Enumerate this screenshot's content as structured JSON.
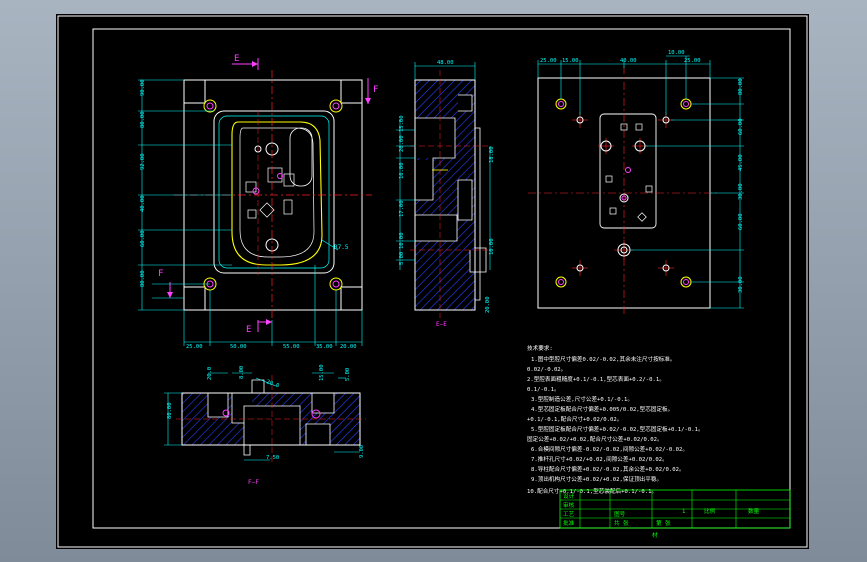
{
  "colors": {
    "background_outer": "#8e9aa8",
    "drawing_paper": "#000000",
    "border": "#ffffff",
    "dimension": "#00ffff",
    "part_outline": "#ffffff",
    "hatch": "#2a3fff",
    "center_line": "#ff2020",
    "cavity": "#ffff00",
    "hole_magenta": "#ff40ff",
    "title_block": "#00ff00",
    "notes_text": "#ffffff"
  },
  "section_labels": {
    "view_top_left_arrow_E_top": "E",
    "view_top_left_arrow_E_bottom": "E",
    "view_top_left_arrow_F_right": "F",
    "view_top_left_arrow_F_left": "F",
    "section_E": "E—E",
    "section_F": "F—F"
  },
  "dims_plan": {
    "left": [
      "90.00",
      "80.00",
      "92.00",
      "40.00",
      "60.00",
      "80.00"
    ],
    "bottom": [
      "25.00",
      "50.00",
      "55.00",
      "35.00",
      "20.00"
    ],
    "callout": "R7.5"
  },
  "dims_section_e": {
    "top": "48.00",
    "left": [
      "15.00",
      "26.00",
      "16.00",
      "17.00",
      "10.00",
      "5.00",
      "20.00"
    ],
    "right": [
      "18.00",
      "10.00"
    ]
  },
  "dims_right_plate": {
    "top": [
      "25.00",
      "15.00",
      "40.00",
      "25.00",
      "10.00"
    ],
    "right": [
      "80.00",
      "60.00",
      "45.00",
      "30.00",
      "60.00",
      "30.00"
    ]
  },
  "dims_section_f": {
    "left": "80.00",
    "top": [
      "20.0",
      "8.00",
      "20.0",
      "15.00",
      "5.00"
    ],
    "bottom": [
      "7.50",
      "9.00"
    ]
  },
  "notes": {
    "heading": "技术要求:",
    "lines": [
      "1.图中型腔尺寸偏差0.02/-0.02,其余未注尺寸按标准。",
      "0.02/-0.02。",
      "2.型腔表面粗糙度+0.1/-0.1,型芯表面+0.2/-0.1。",
      "0.1/-0.1。",
      "3.型腔制造公差,尺寸公差+0.1/-0.1。",
      "4.型芯固定板配合尺寸偏差+0.005/0.02,型芯固定板。",
      "+0.1/-0.1,配合尺寸+0.02/0.02。",
      "5.型腔固定板配合尺寸偏差+0.02/-0.02,型芯固定板+0.1/-0.1。",
      "固定公差+0.02/+0.02,配合尺寸公差+0.02/0.02。",
      "6.合模间隙尺寸偏差-0.02/-0.02,间隙公差+0.02/-0.02。",
      "7.推杆孔尺寸+0.02/+0.02,间隙公差+0.02/0.02。",
      "8.导柱配合尺寸偏差+0.02/-0.02,其余公差+0.02/0.02。",
      "9.顶出机构尺寸公差+0.02/+0.02,保证顶出平稳。",
      "10.配合尺寸+0.1/-0.1,型芯装配后+0.1/-0.1。"
    ]
  },
  "title_block": {
    "row1": [
      "设计",
      "",
      "",
      "",
      "",
      ""
    ],
    "row2": [
      "审核",
      "",
      "图号",
      "1",
      "比例",
      "数量"
    ],
    "row3": [
      "工艺",
      "",
      "",
      "",
      "",
      ""
    ],
    "row4": [
      "批准",
      "",
      "共 张",
      "第 张",
      "",
      ""
    ],
    "bottom_mark": "材"
  }
}
